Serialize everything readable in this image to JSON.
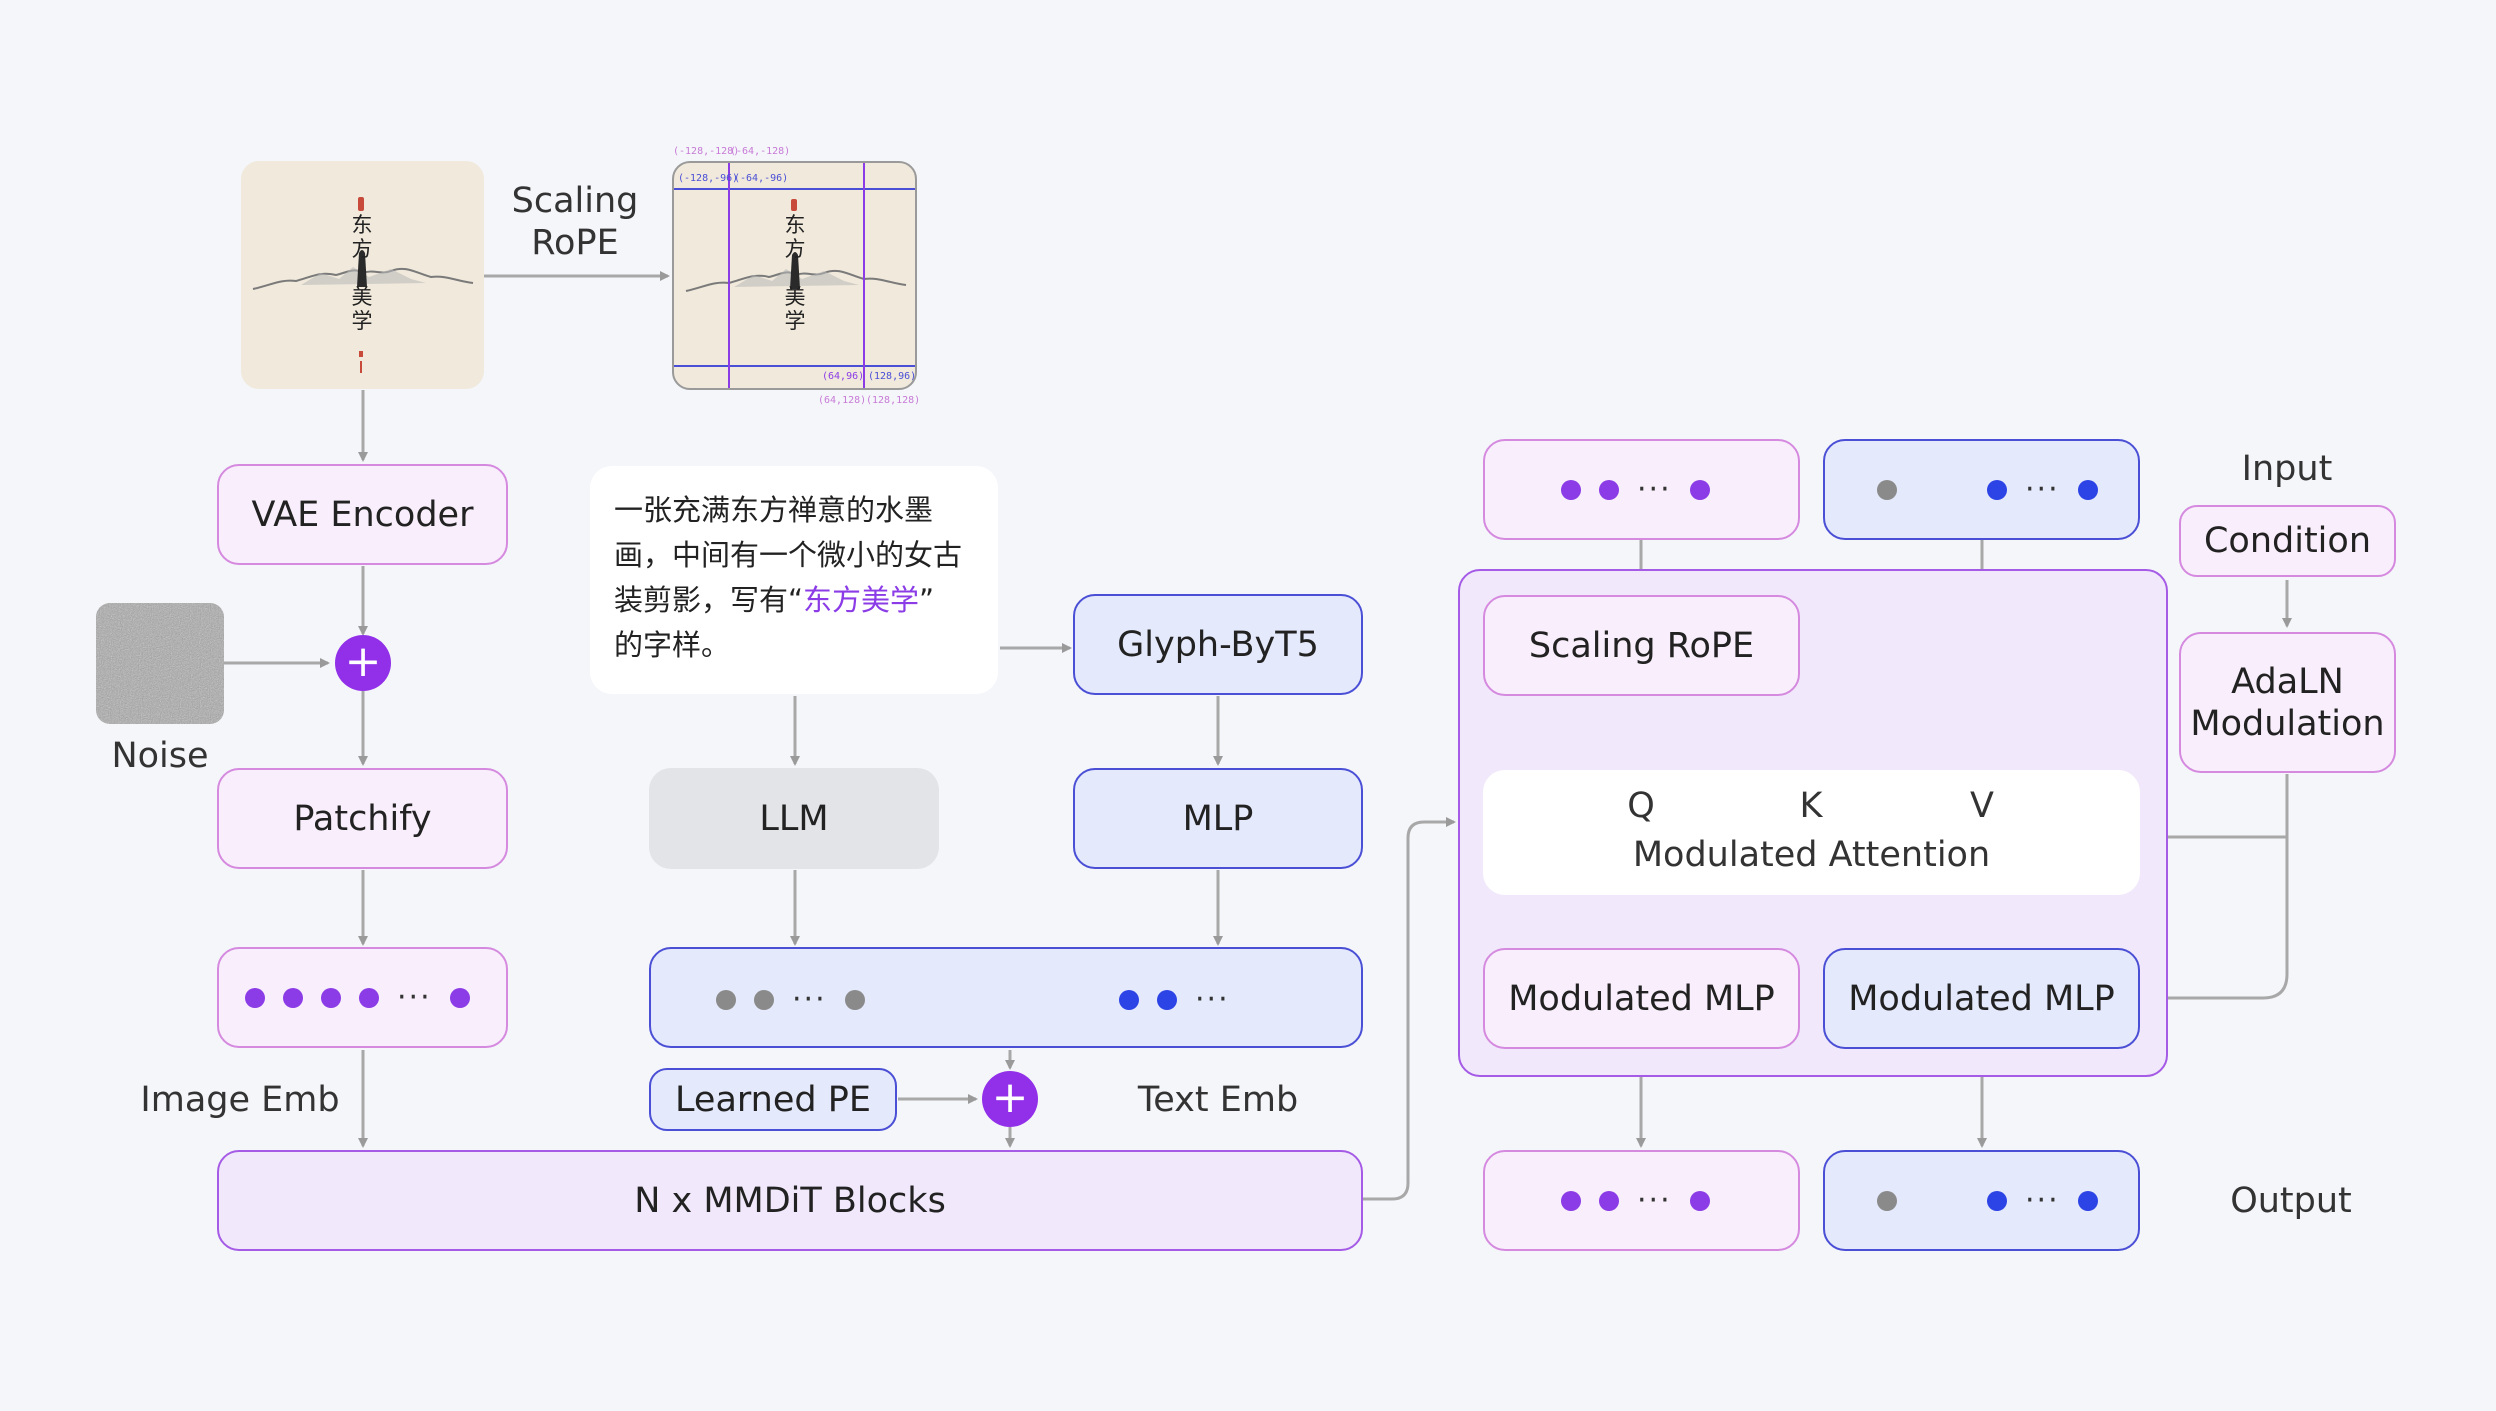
{
  "scaling_rope_top": {
    "line1": "Scaling",
    "line2": "RoPE"
  },
  "image_text_chars": [
    "东",
    "方",
    "美",
    "学"
  ],
  "image_coords": {
    "top_outer_left": "(-128,-128)",
    "top_outer_right": "(-64,-128)",
    "top_inner_left": "(-128,-96)",
    "top_inner_right": "(-64,-96)",
    "bottom_inner_left": "(64,96)",
    "bottom_inner_right": "(128,96)",
    "bottom_outer_left": "(64,128)",
    "bottom_outer_right": "(128,128)"
  },
  "vae_encoder": "VAE Encoder",
  "noise_label": "Noise",
  "patchify": "Patchify",
  "image_emb_label": "Image Emb",
  "prompt": {
    "line1": "一张充满东方禅意的水墨",
    "line2": "画，中间有一个微小的女古",
    "line3_pre": "装剪影，写有“",
    "line3_hl": "东方美学",
    "line3_post": "”",
    "line4": "的字样。"
  },
  "glyph_byt5": "Glyph-ByT5",
  "llm": "LLM",
  "mlp": "MLP",
  "learned_pe": "Learned PE",
  "text_emb_label": "Text Emb",
  "mmdit_blocks": "N x MMDiT Blocks",
  "ellipsis": "···",
  "block_detail": {
    "scaling_rope": "Scaling RoPE",
    "q": "Q",
    "k": "K",
    "v": "V",
    "modulated_attention": "Modulated Attention",
    "modulated_mlp_left": "Modulated MLP",
    "modulated_mlp_right": "Modulated MLP"
  },
  "input_label": "Input",
  "condition": "Condition",
  "adaln": {
    "line1": "AdaLN",
    "line2": "Modulation"
  },
  "output_label": "Output",
  "colors": {
    "purple": "#8b3ce6",
    "blue": "#2c43e6",
    "gray": "#8a8a8a",
    "pink_border": "#d58ae0",
    "blue_border": "#4a4fd6"
  }
}
